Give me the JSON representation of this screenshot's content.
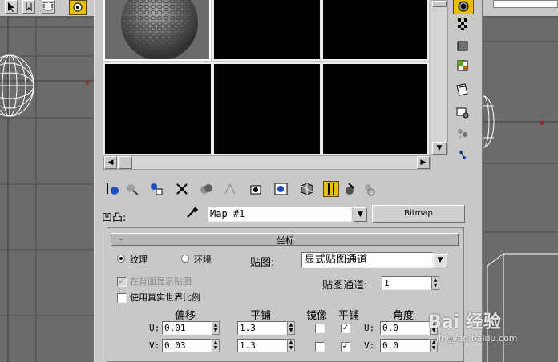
{
  "top_toolbar": {
    "icons": [
      "select-icon",
      "cursor-icon",
      "region-select-icon",
      "snap-icon"
    ]
  },
  "material_editor": {
    "sample_slots_count": 6,
    "tools_right": [
      "sample-type-icon",
      "backlight-icon",
      "background-icon",
      "sample-uv-tiling-icon",
      "video-color-check-icon",
      "make-preview-icon",
      "options-icon",
      "select-by-material-icon",
      "material-map-navigator-icon"
    ],
    "tools_bottom": [
      "get-material-icon",
      "put-to-scene-icon",
      "assign-to-selection-icon",
      "reset-map-icon",
      "make-unique-icon",
      "put-to-library-icon",
      "material-effects-channel-icon",
      "show-map-in-viewport-icon",
      "show-end-result-icon",
      "go-to-parent-icon",
      "go-forward-to-sibling-icon"
    ],
    "map_row": {
      "label": "凹凸:",
      "map_name": "Map #1",
      "map_type_button": "Bitmap"
    },
    "rollout": {
      "collapse_sign": "-",
      "title": "坐标",
      "radio_texture": "纹理",
      "radio_environ": "环境",
      "mapping_label": "贴图:",
      "mapping_value": "显式贴图通道",
      "show_map_on_back": "在背面显示贴图",
      "use_real_world_scale": "使用真实世界比例",
      "map_channel_label": "贴图通道:",
      "map_channel_value": "1",
      "headers": {
        "offset": "偏移",
        "tiling": "平铺",
        "mirror": "镜像",
        "tile": "平铺",
        "angle": "角度"
      },
      "rows": [
        {
          "axis": "U:",
          "offset": "0.01",
          "tiling": "1.3",
          "mirror": false,
          "tile": true,
          "angle_axis": "U:",
          "angle": "0.0"
        },
        {
          "axis": "V:",
          "offset": "0.03",
          "tiling": "1.3",
          "mirror": false,
          "tile": true,
          "angle_axis": "V:",
          "angle": "0.0"
        }
      ]
    }
  },
  "watermark": {
    "brand": "Bai 经验",
    "url": "jingyan.baidu.com"
  }
}
